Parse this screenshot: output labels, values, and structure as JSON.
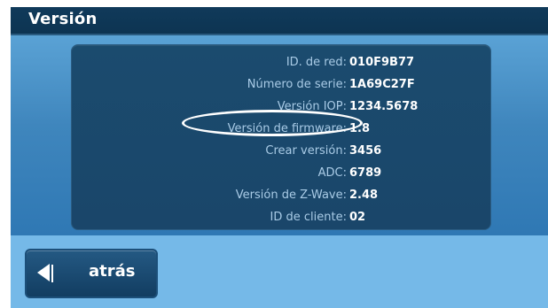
{
  "window": {
    "title": "Versión"
  },
  "info": {
    "rows": [
      {
        "label": "ID. de red:",
        "value": "010F9B77"
      },
      {
        "label": "Número de serie:",
        "value": "1A69C27F"
      },
      {
        "label": "Versión IOP:",
        "value": "1234.5678"
      },
      {
        "label": "Versión de firmware:",
        "value": "1.8"
      },
      {
        "label": "Crear versión:",
        "value": "3456"
      },
      {
        "label": "ADC:",
        "value": "6789"
      },
      {
        "label": "Versión de Z-Wave:",
        "value": "2.48"
      },
      {
        "label": "ID de cliente:",
        "value": "02"
      }
    ]
  },
  "footer": {
    "back_label": "atrás"
  },
  "colors": {
    "title_bg": "#103a5a",
    "panel_bg": "#1b4b6e",
    "label_text": "#a9cbe6",
    "value_text": "#ffffff",
    "footer_bg": "#75b9e8",
    "button_bg": "#123d61"
  },
  "icons": {
    "back": "left-arrow-icon"
  }
}
